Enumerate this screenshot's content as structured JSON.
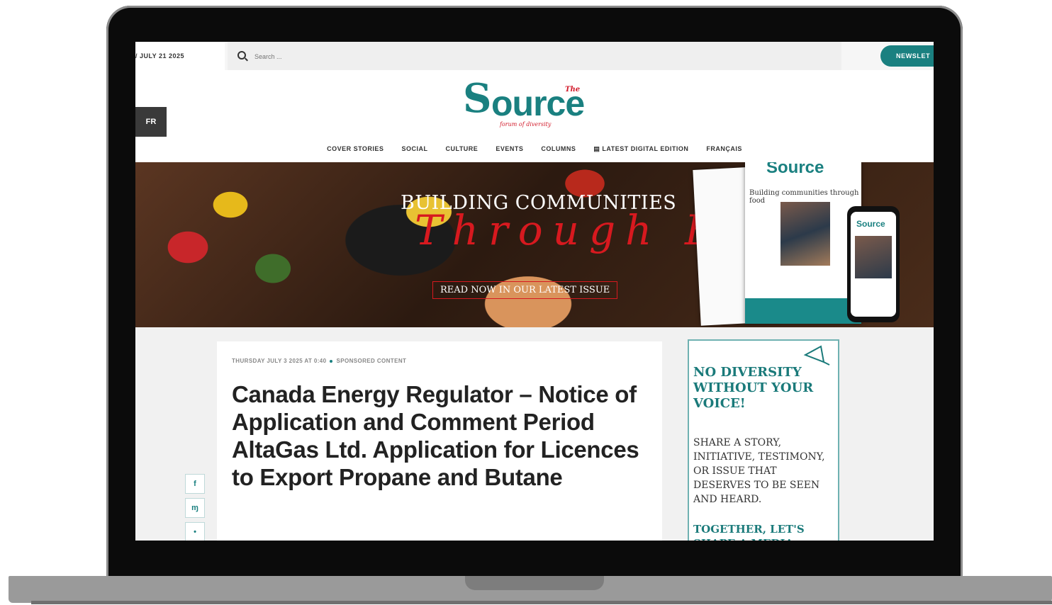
{
  "topbar": {
    "date": "/ JULY 21 2025",
    "search_placeholder": "Search ...",
    "newsletter_label": "NEWSLET"
  },
  "header": {
    "lang_button": "FR",
    "logo_the": "The",
    "logo_s": "S",
    "logo_rest": "ource",
    "logo_tagline": "forum of diversity"
  },
  "nav": {
    "items": [
      "COVER STORIES",
      "SOCIAL",
      "CULTURE",
      "EVENTS",
      "COLUMNS",
      "▤ LATEST DIGITAL EDITION",
      "FRANÇAIS"
    ]
  },
  "hero": {
    "title": "BUILDING COMMUNITIES",
    "script": "Through Food",
    "cta": "READ NOW IN OUR LATEST ISSUE",
    "magazine_logo": "Source",
    "magazine_headline": "Building communities through food",
    "phone_logo": "Source"
  },
  "article": {
    "date": "THURSDAY JULY 3 2025 AT 0:40",
    "category": "SPONSORED CONTENT",
    "headline": "Canada Energy Regulator – Notice of Application and Comment Period AltaGas Ltd. Application for Licences to Export Propane and Butane"
  },
  "share": {
    "facebook": "f",
    "bluesky": "ɱ",
    "twitter": "•"
  },
  "sidebar": {
    "heading": "NO DIVERSITY WITHOUT YOUR VOICE!",
    "body": "SHARE A STORY, INITIATIVE, TESTIMONY, OR ISSUE THAT DESERVES TO BE SEEN AND HEARD.",
    "cta": "TOGETHER, LET'S SHAPE A MEDIA"
  },
  "colors": {
    "brand_teal": "#1a8080",
    "brand_red": "#d21b2b"
  }
}
